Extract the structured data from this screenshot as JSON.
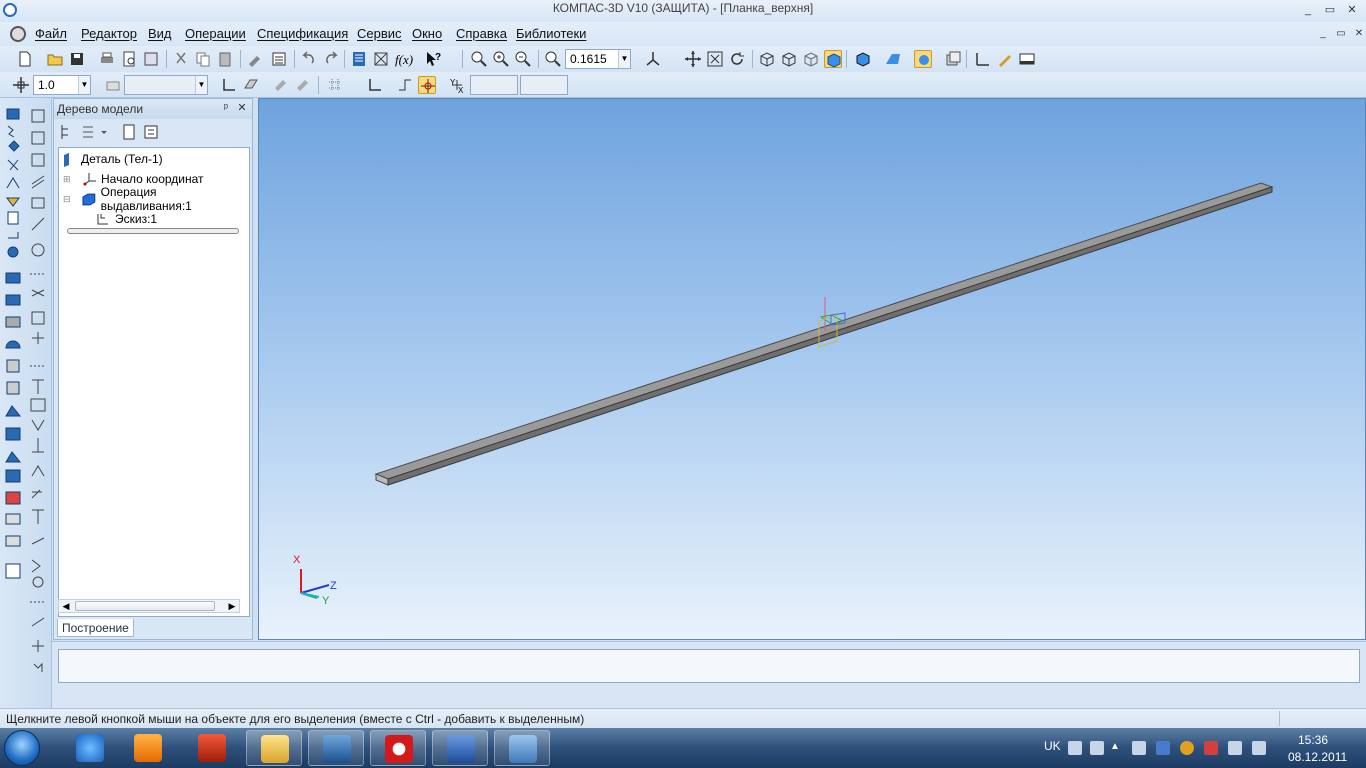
{
  "window": {
    "title": "КОМПАС-3D V10 (ЗАЩИТА) - [Планка_верхня]",
    "minimize": "_",
    "maximize": "▭",
    "close": "✕"
  },
  "menu": {
    "items": [
      "Файл",
      "Редактор",
      "Вид",
      "Операции",
      "Спецификация",
      "Сервис",
      "Окно",
      "Справка",
      "Библиотеки"
    ],
    "doc_minimize": "_",
    "doc_restore": "▭",
    "doc_close": "✕"
  },
  "toolbar": {
    "zoom_value": "0.1615",
    "step_value": "1.0"
  },
  "model_tree": {
    "header": "Дерево модели",
    "pin": "ᵖ",
    "close": "✕",
    "nodes": [
      {
        "label": "Деталь (Тел-1)"
      },
      {
        "label": "Начало координат"
      },
      {
        "label": "Операция выдавливания:1"
      },
      {
        "label": "Эскиз:1"
      }
    ],
    "tab": "Построение"
  },
  "viewport": {
    "axis_x": "X",
    "axis_y": "Y",
    "axis_z": "Z"
  },
  "status": {
    "message": "Щелкните левой кнопкой мыши на объекте для его выделения (вместе с Ctrl - добавить к выделенным)"
  },
  "taskbar": {
    "language": "UK",
    "time": "15:36",
    "date": "08.12.2011"
  },
  "colors": {
    "accent": "#2a6ab5",
    "viewport_top": "#6fa3de",
    "viewport_bottom": "#e9f2fb",
    "part_color": "#8a8a8a"
  }
}
